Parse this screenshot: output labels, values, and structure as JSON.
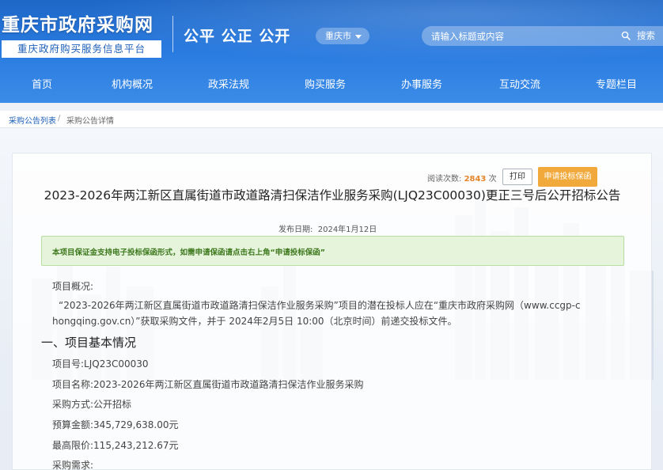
{
  "header": {
    "site_title": "重庆市政府采购网",
    "site_subtitle": "重庆政府购买服务信息平台",
    "slogan": "公平 公正 公开",
    "region": "重庆市",
    "search_placeholder": "请输入标题或内容",
    "search_label": "搜索"
  },
  "nav": {
    "items": [
      {
        "label": "首页"
      },
      {
        "label": "机构概况"
      },
      {
        "label": "政采法规"
      },
      {
        "label": "购买服务"
      },
      {
        "label": "办事服务"
      },
      {
        "label": "互动交流"
      },
      {
        "label": "专题栏目"
      }
    ]
  },
  "breadcrumb": {
    "first": "采购公告列表",
    "separator": "/",
    "second": "采购公告详情"
  },
  "article": {
    "view_label": "阅读次数:",
    "view_count": "2843",
    "view_unit": "次",
    "print_label": "打印",
    "guarantee_label": "申请投标保函",
    "title": "2023-2026年两江新区直属街道市政道路清扫保洁作业服务采购(LJQ23C00030)更正三号后公开招标公告",
    "pubdate_label": "发布日期:",
    "pubdate": "2024年1月12日",
    "notice": "本项目保证金支持电子投标保函形式，如需申请保函请点击右上角“申请投标保函”",
    "overview_label": "项目概况:",
    "overview_line1": "“2023-2026年两江新区直属街道市政道路清扫保洁作业服务采购”项目的潜在投标人应在“重庆市政府采购网（www.ccgp-c",
    "overview_line2": "hongqing.gov.cn）”获取采购文件，并于 2024年2月5日 10:00（北京时间）前递交投标文件。",
    "section1": "一、项目基本情况",
    "fields": [
      {
        "label": "项目号:",
        "value": "LJQ23C00030"
      },
      {
        "label": "项目名称:",
        "value": "2023-2026年两江新区直属街道市政道路清扫保洁作业服务采购"
      },
      {
        "label": "采购方式:",
        "value": "公开招标"
      },
      {
        "label": "预算金额:",
        "value": "345,729,638.00元"
      },
      {
        "label": "最高限价:",
        "value": "115,243,212.67元"
      },
      {
        "label": "采购需求:",
        "value": ""
      }
    ]
  }
}
